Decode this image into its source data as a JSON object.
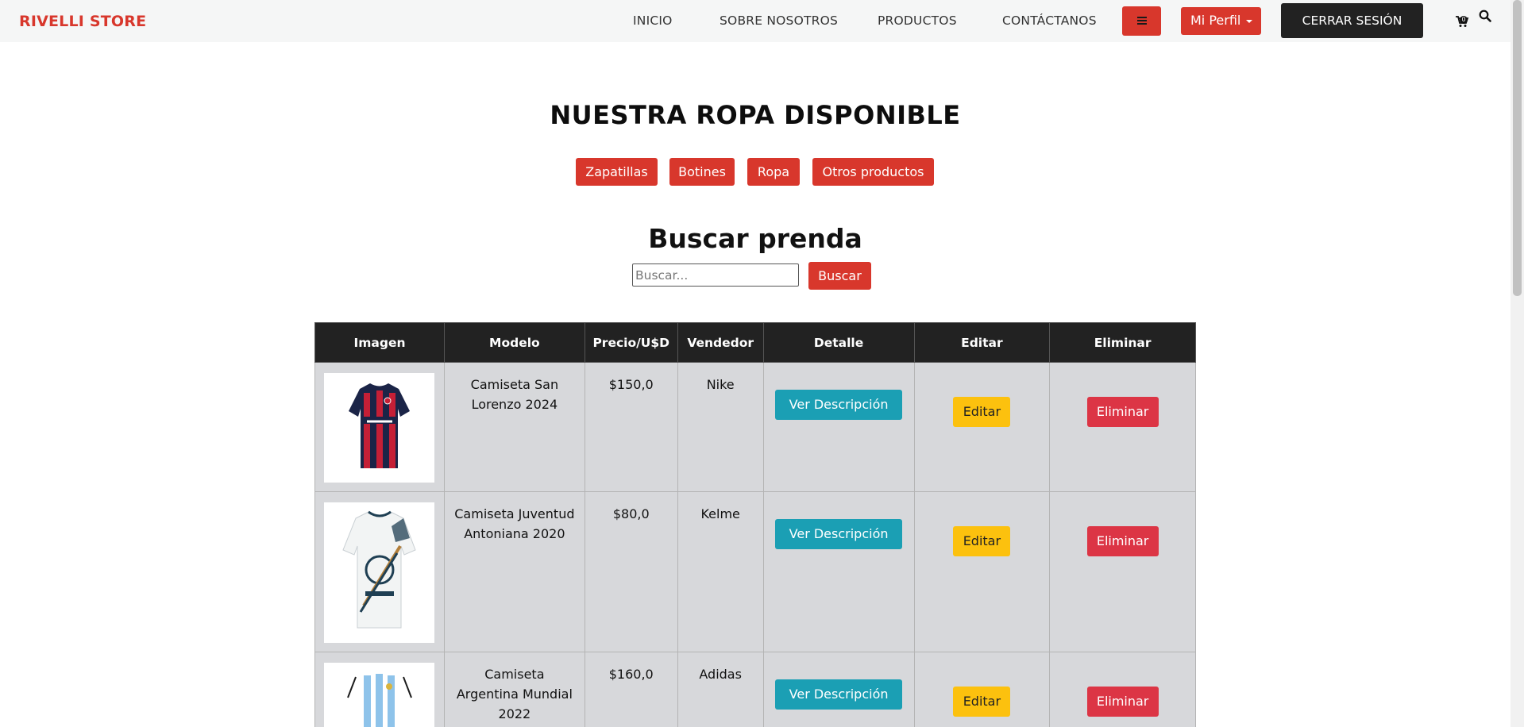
{
  "nav": {
    "brand": "RIVELLI STORE",
    "links": [
      "INICIO",
      "SOBRE NOSOTROS",
      "PRODUCTOS",
      "CONTÁCTANOS"
    ],
    "menu_icon": "bars-icon",
    "profile_label": "Mi Perfil",
    "logout_label": "CERRAR SESIÓN",
    "cart_icon": "cart-icon",
    "cart_count": "0",
    "search_icon": "search-icon"
  },
  "main": {
    "title": "NUESTRA ROPA DISPONIBLE",
    "filters": [
      "Zapatillas",
      "Botines",
      "Ropa",
      "Otros productos"
    ]
  },
  "search": {
    "title": "Buscar prenda",
    "placeholder": "Buscar...",
    "button_label": "Buscar"
  },
  "table": {
    "headers": [
      "Imagen",
      "Modelo",
      "Precio/U$D",
      "Vendedor",
      "Detalle",
      "Editar",
      "Eliminar"
    ],
    "rows": [
      {
        "image": "San Lorenzo jersey",
        "model": "Camiseta San Lorenzo 2024",
        "price": "$150,0",
        "vendor": "Nike",
        "detail_label": "Ver Descripción",
        "edit_label": "Editar",
        "delete_label": "Eliminar"
      },
      {
        "image": "Juventud Antoniana jersey",
        "model": "Camiseta Juventud Antoniana 2020",
        "price": "$80,0",
        "vendor": "Kelme",
        "detail_label": "Ver Descripción",
        "edit_label": "Editar",
        "delete_label": "Eliminar"
      },
      {
        "image": "Argentina jersey",
        "model": "Camiseta Argentina Mundial 2022",
        "price": "$160,0",
        "vendor": "Adidas",
        "detail_label": "Ver Descripción",
        "edit_label": "Editar",
        "delete_label": "Eliminar"
      }
    ]
  },
  "colors": {
    "brand_red": "#d8372c",
    "dark": "#222222",
    "info": "#1b9fb4",
    "warning": "#fcc10e",
    "danger": "#dc3545"
  }
}
